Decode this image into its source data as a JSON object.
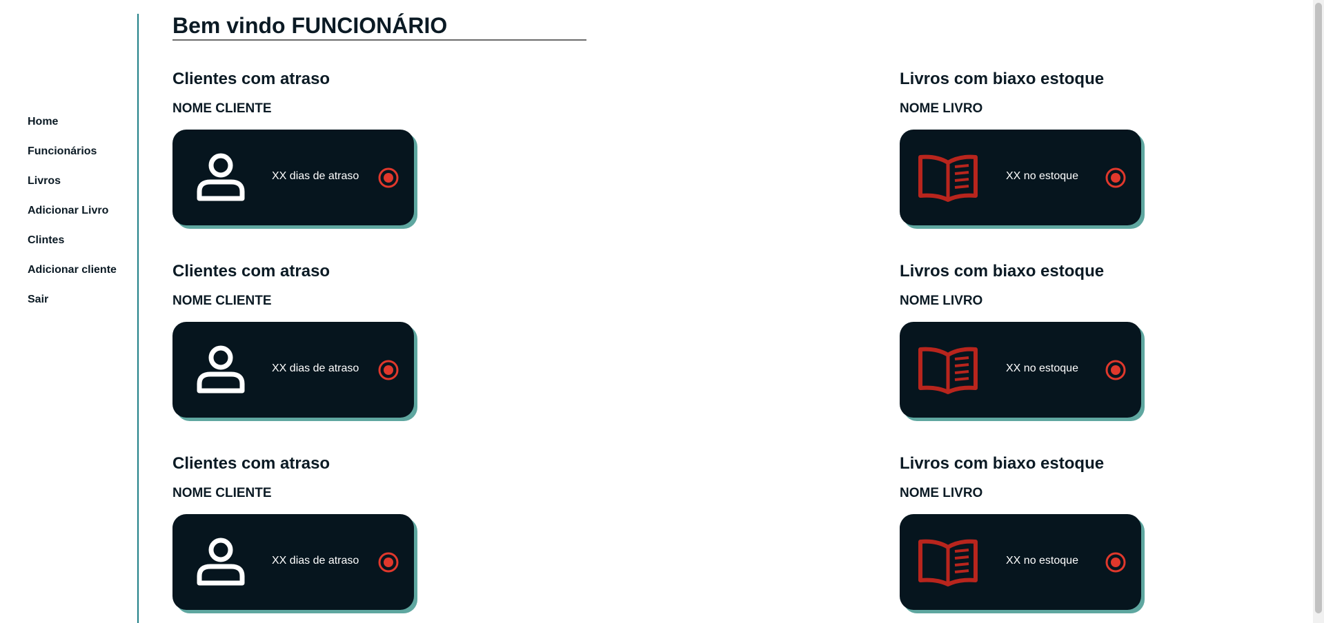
{
  "sidebar": {
    "items": [
      {
        "label": "Home"
      },
      {
        "label": "Funcionários"
      },
      {
        "label": "Livros"
      },
      {
        "label": "Adicionar Livro"
      },
      {
        "label": "Clintes"
      },
      {
        "label": "Adicionar cliente"
      },
      {
        "label": "Sair"
      }
    ]
  },
  "header": {
    "title": "Bem vindo FUNCIONÁRIO"
  },
  "clients": [
    {
      "title": "Clientes com atraso",
      "name": "NOME CLIENTE",
      "info": "XX dias de atraso",
      "icon": "user-icon"
    },
    {
      "title": "Clientes com atraso",
      "name": "NOME CLIENTE",
      "info": "XX dias de atraso",
      "icon": "user-icon"
    },
    {
      "title": "Clientes com atraso",
      "name": "NOME CLIENTE",
      "info": "XX dias de atraso",
      "icon": "user-icon"
    }
  ],
  "books": [
    {
      "title": "Livros com biaxo estoque",
      "name": "NOME LIVRO",
      "info": "XX no estoque",
      "icon": "book-icon"
    },
    {
      "title": "Livros com biaxo estoque",
      "name": "NOME LIVRO",
      "info": "XX no estoque",
      "icon": "book-icon"
    },
    {
      "title": "Livros com biaxo estoque",
      "name": "NOME LIVRO",
      "info": "XX no estoque",
      "icon": "book-icon"
    }
  ],
  "colors": {
    "card_bg": "#06151e",
    "card_shadow": "#5fa7a0",
    "accent_red": "#e0382c",
    "book_icon": "#b8251d",
    "sidebar_line": "#1f7f86"
  }
}
